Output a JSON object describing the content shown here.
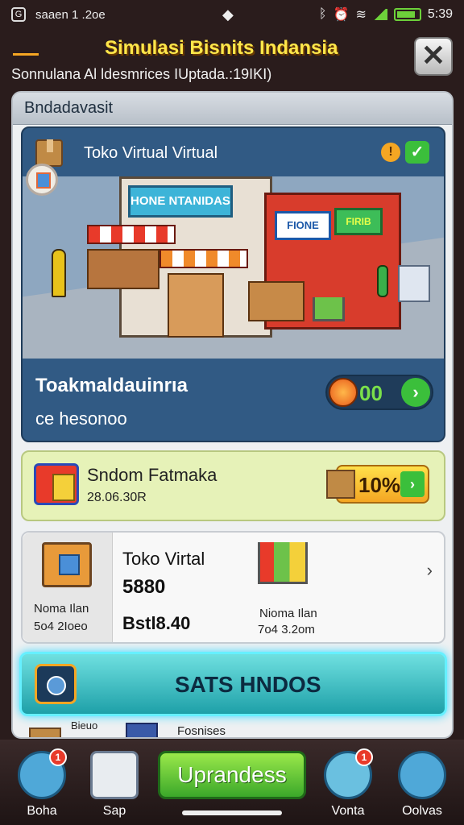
{
  "status_bar": {
    "app_glyph": "G",
    "left_text": "saaen 1 .2oe",
    "time": "5:39"
  },
  "header": {
    "title": "Simulasi Bisnits Indansia",
    "subtitle": "Sonnulana Al ldesmrices IUptada.:19IKI)",
    "close_icon": "close-icon"
  },
  "panel": {
    "title": "Bndadavasit",
    "store": {
      "name": "Toko Virtual Virtual",
      "scene_sign_1": "HONE NTANIDAS",
      "scene_sign_2": "FIONE",
      "scene_sign_3": "FIRIB",
      "label": "Toakmaldauinrıa",
      "sub": "ce hesonoo",
      "coin_value": "00",
      "warn_glyph": "!",
      "check_glyph": "✓",
      "go_glyph": "›"
    },
    "deal": {
      "title": "Sndom Fatmaka",
      "sub": "28.06.30R",
      "value": "10%",
      "go_glyph": "›"
    },
    "info": {
      "col1_label": "Noma Ilan",
      "col1_value": "5o4 2Ioeo",
      "title": "Toko Virtal",
      "number": "5880",
      "big": "Bstl8.40",
      "col3_label": "Nioma Ilan",
      "col3_value": "7o4 3.2om",
      "chevron": "›"
    },
    "cta": {
      "label": "SATS HNDOS"
    },
    "peek": {
      "a": "Bieuo",
      "b": "Fosnises"
    }
  },
  "bottom_nav": {
    "items": [
      {
        "label": "Boha",
        "badge": "1"
      },
      {
        "label": "Sap",
        "badge": ""
      },
      {
        "label": "Vonta",
        "badge": "1"
      },
      {
        "label": "Oolvas",
        "badge": ""
      }
    ],
    "upgrade_label": "Uprandess"
  },
  "colors": {
    "title_yellow": "#ffe74a",
    "accent_green": "#3bbf3b",
    "cta_teal": "#1ea0a8",
    "store_blue": "#315a84"
  }
}
